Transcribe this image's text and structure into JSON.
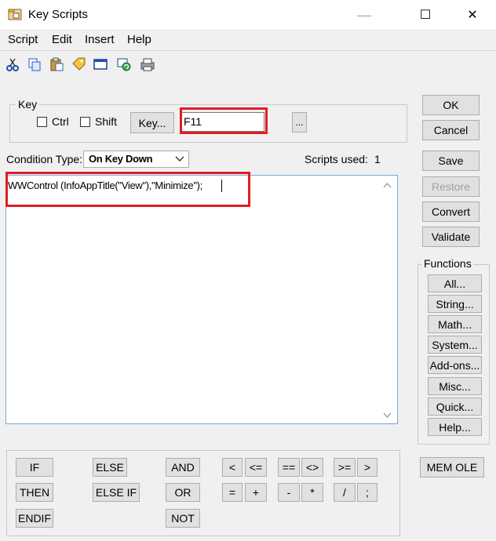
{
  "window": {
    "title": "Key Scripts",
    "minimize": "—",
    "maximize": "☐",
    "close": "✕"
  },
  "menu": {
    "items": [
      {
        "label": "Script"
      },
      {
        "label": "Edit"
      },
      {
        "label": "Insert"
      },
      {
        "label": "Help"
      }
    ]
  },
  "toolbar": {
    "icons": [
      "cut-icon",
      "copy-icon",
      "paste-icon",
      "tag-icon",
      "window-icon",
      "refresh-icon",
      "print-icon"
    ]
  },
  "key": {
    "group_label": "Key",
    "ctrl_label": "Ctrl",
    "shift_label": "Shift",
    "key_button": "Key...",
    "value": "F11",
    "browse_button": "..."
  },
  "condition": {
    "label": "Condition Type:",
    "value": "On Key Down",
    "scripts_used_label": "Scripts used:",
    "scripts_used": "1"
  },
  "editor": {
    "code": "WWControl (InfoAppTitle(\"View\"),\"Minimize\");"
  },
  "side_buttons": {
    "ok": "OK",
    "cancel": "Cancel",
    "save": "Save",
    "restore": "Restore",
    "convert": "Convert",
    "validate": "Validate"
  },
  "functions": {
    "label": "Functions",
    "buttons": [
      "All...",
      "String...",
      "Math...",
      "System...",
      "Add-ons...",
      "Misc...",
      "Quick...",
      "Help..."
    ]
  },
  "operators": {
    "if": "IF",
    "then": "THEN",
    "endif": "ENDIF",
    "else": "ELSE",
    "elseif": "ELSE IF",
    "and": "AND",
    "or": "OR",
    "not": "NOT",
    "lt": "<",
    "le": "<=",
    "eq": "==",
    "ne": "<>",
    "ge": ">=",
    "gt": ">",
    "assign": "=",
    "plus": "+",
    "minus": "-",
    "mult": "*",
    "div": "/",
    "semi": ";"
  },
  "mem_ole": "MEM OLE"
}
